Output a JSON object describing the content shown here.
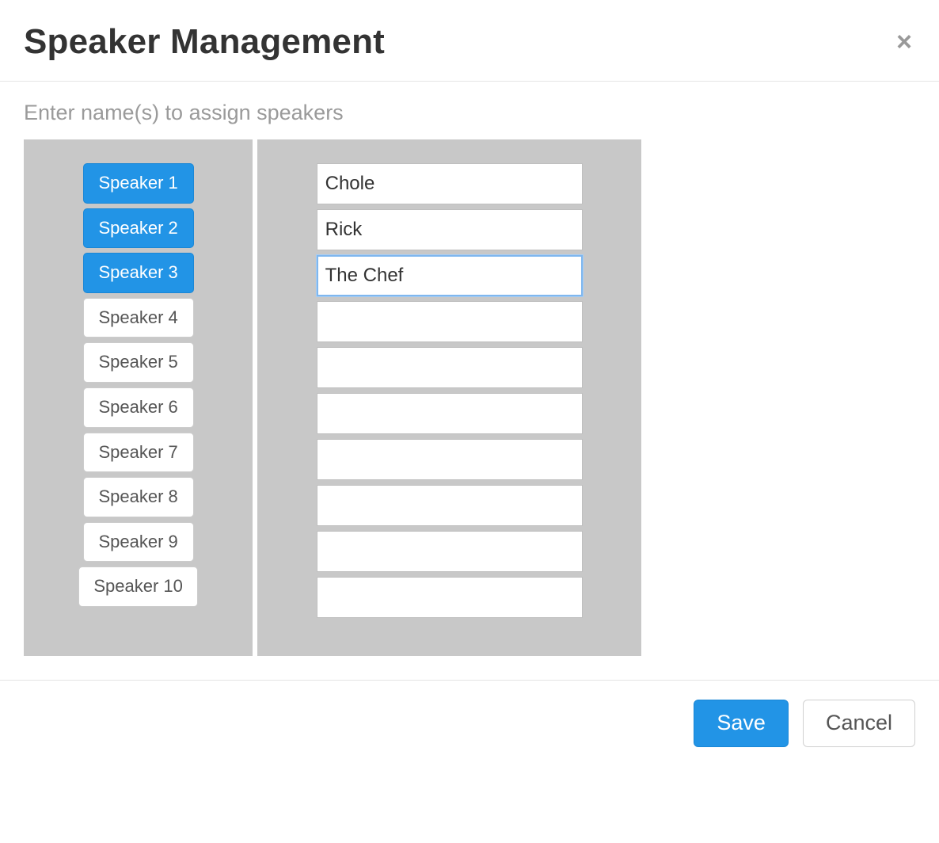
{
  "header": {
    "title": "Speaker Management",
    "close_glyph": "×"
  },
  "instruction": "Enter name(s) to assign speakers",
  "speakers": [
    {
      "label": "Speaker 1",
      "name": "Chole",
      "active": true,
      "focused": false
    },
    {
      "label": "Speaker 2",
      "name": "Rick",
      "active": true,
      "focused": false
    },
    {
      "label": "Speaker 3",
      "name": "The Chef",
      "active": true,
      "focused": true
    },
    {
      "label": "Speaker 4",
      "name": "",
      "active": false,
      "focused": false
    },
    {
      "label": "Speaker 5",
      "name": "",
      "active": false,
      "focused": false
    },
    {
      "label": "Speaker 6",
      "name": "",
      "active": false,
      "focused": false
    },
    {
      "label": "Speaker 7",
      "name": "",
      "active": false,
      "focused": false
    },
    {
      "label": "Speaker 8",
      "name": "",
      "active": false,
      "focused": false
    },
    {
      "label": "Speaker 9",
      "name": "",
      "active": false,
      "focused": false
    },
    {
      "label": "Speaker 10",
      "name": "",
      "active": false,
      "focused": false
    }
  ],
  "footer": {
    "save_label": "Save",
    "cancel_label": "Cancel"
  }
}
